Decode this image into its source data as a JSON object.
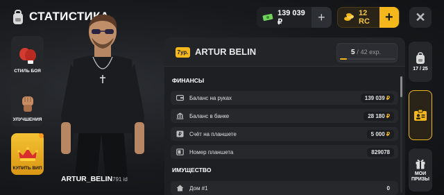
{
  "header": {
    "title": "СТАТИСТИКА",
    "money_value": "139 039 ₽",
    "rc_value": "12 RC",
    "plus_label": "+",
    "close_label": "✕"
  },
  "left_menu": {
    "items": [
      {
        "label": "СТИЛЬ БОЯ",
        "icon": "boxing-gloves-icon"
      },
      {
        "label": "УЛУЧШЕНИЯ",
        "icon": "fist-icon"
      },
      {
        "label": "КУПИТЬ ВИП",
        "icon": "crown-icon"
      }
    ]
  },
  "character": {
    "name": "ARTUR_BELIN",
    "id": "791 id"
  },
  "profile": {
    "level": "7ур.",
    "name": "ARTUR BELIN",
    "exp_current": "5",
    "exp_separator": "/",
    "exp_total": "42 exp.",
    "exp_progress": 0.12
  },
  "finances": {
    "title": "ФИНАНСЫ",
    "rows": [
      {
        "label": "Баланс на руках",
        "value": "139 039",
        "currency": "₽",
        "icon": "wallet-icon"
      },
      {
        "label": "Баланс в банке",
        "value": "28 180",
        "currency": "₽",
        "icon": "bank-icon"
      },
      {
        "label": "Счёт на планшете",
        "value": "5 000",
        "currency": "₽",
        "icon": "tablet-account-icon"
      },
      {
        "label": "Номер планшета",
        "value": "829078",
        "currency": "",
        "icon": "tablet-icon"
      }
    ]
  },
  "property": {
    "title": "ИМУЩЕСТВО",
    "rows": [
      {
        "label": "Дом #1",
        "value": "0",
        "icon": "house-icon"
      }
    ]
  },
  "right_menu": {
    "backpack_count": "17 / 25",
    "prizes_label": "МОИ ПРИЗЫ"
  },
  "colors": {
    "accent": "#f5b81c",
    "money_green": "#6fd35a",
    "background": "#17191c"
  }
}
